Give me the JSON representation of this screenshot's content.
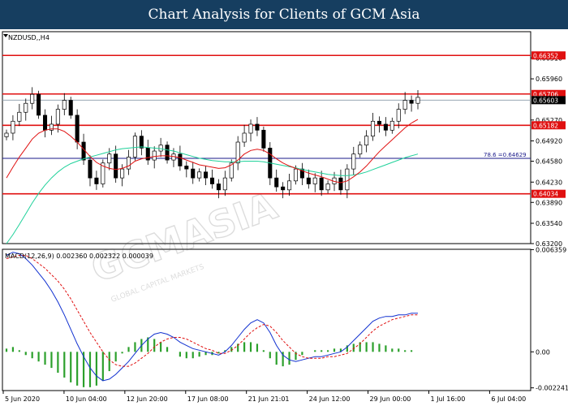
{
  "banner": {
    "title": "Chart Analysis for Clients of GCM Asia"
  },
  "watermark": {
    "text": "GCMASIA",
    "sub": "GLOBAL CAPITAL MARKETS"
  },
  "chart_data": [
    {
      "type": "candlestick",
      "title": "NZDUSD,,H4",
      "ylim": [
        0.632,
        0.6675
      ],
      "y_ticks": [
        "0.66310",
        "0.65960",
        "0.65270",
        "0.64920",
        "0.64580",
        "0.64230",
        "0.63890",
        "0.63540",
        "0.63200"
      ],
      "x_ticks": [
        "5 Jun 2020",
        "10 Jun 04:00",
        "12 Jun 20:00",
        "17 Jun 08:00",
        "21 Jun 21:01",
        "24 Jun 12:00",
        "29 Jun 00:00",
        "1 Jul 16:00",
        "6 Jul 04:00"
      ],
      "levels": [
        {
          "label": "0.66352",
          "value": 0.66352,
          "color": "#e01010"
        },
        {
          "label": "0.65706",
          "value": 0.65706,
          "color": "#e01010"
        },
        {
          "label": "0.65182",
          "value": 0.65182,
          "color": "#e01010"
        },
        {
          "label": "0.64034",
          "value": 0.64034,
          "color": "#e01010"
        }
      ],
      "fib_level": {
        "label": "78.6 =0.64629",
        "value": 0.64629,
        "color": "#1a1a8a"
      },
      "current_price": {
        "label": "0.65603",
        "value": 0.65603
      },
      "series": [
        {
          "kind": "close",
          "color": "#000000",
          "values": [
            0.6505,
            0.6525,
            0.654,
            0.6555,
            0.657,
            0.6535,
            0.651,
            0.652,
            0.6545,
            0.656,
            0.6535,
            0.649,
            0.646,
            0.643,
            0.642,
            0.6455,
            0.647,
            0.643,
            0.6445,
            0.6465,
            0.65,
            0.648,
            0.646,
            0.6475,
            0.6485,
            0.646,
            0.647,
            0.645,
            0.6445,
            0.643,
            0.644,
            0.643,
            0.642,
            0.641,
            0.643,
            0.6455,
            0.649,
            0.6505,
            0.652,
            0.651,
            0.648,
            0.643,
            0.6415,
            0.641,
            0.6425,
            0.6445,
            0.643,
            0.642,
            0.643,
            0.641,
            0.642,
            0.643,
            0.641,
            0.6445,
            0.647,
            0.6485,
            0.65,
            0.6525,
            0.652,
            0.651,
            0.6525,
            0.6545,
            0.656,
            0.6555,
            0.6565
          ]
        },
        {
          "kind": "ma_slow",
          "color": "#1fd19a",
          "values": [
            0.632,
            0.6335,
            0.6352,
            0.637,
            0.6388,
            0.6404,
            0.6418,
            0.643,
            0.644,
            0.6448,
            0.6454,
            0.6458,
            0.6462,
            0.6465,
            0.6468,
            0.6471,
            0.6474,
            0.6477,
            0.6479,
            0.648,
            0.6481,
            0.6482,
            0.6481,
            0.648,
            0.6479,
            0.6477,
            0.6475,
            0.6472,
            0.6469,
            0.6466,
            0.6463,
            0.6461,
            0.6459,
            0.6458,
            0.6457,
            0.6457,
            0.6457,
            0.6458,
            0.6458,
            0.6458,
            0.6457,
            0.6455,
            0.6453,
            0.6451,
            0.6449,
            0.6447,
            0.6444,
            0.6442,
            0.644,
            0.6438,
            0.6436,
            0.6435,
            0.6434,
            0.6434,
            0.6435,
            0.6437,
            0.644,
            0.6444,
            0.6448,
            0.6452,
            0.6456,
            0.646,
            0.6464,
            0.6467,
            0.647
          ]
        },
        {
          "kind": "ma_fast",
          "color": "#e01010",
          "values": [
            0.643,
            0.6448,
            0.6465,
            0.648,
            0.6495,
            0.6505,
            0.651,
            0.6512,
            0.6512,
            0.6508,
            0.65,
            0.649,
            0.6478,
            0.6466,
            0.6456,
            0.645,
            0.6446,
            0.6444,
            0.6446,
            0.645,
            0.6458,
            0.6462,
            0.6464,
            0.6466,
            0.6467,
            0.6467,
            0.6466,
            0.6464,
            0.646,
            0.6456,
            0.6452,
            0.645,
            0.6448,
            0.6446,
            0.6447,
            0.6452,
            0.646,
            0.647,
            0.6476,
            0.6478,
            0.6476,
            0.647,
            0.6462,
            0.6455,
            0.645,
            0.6446,
            0.6442,
            0.6438,
            0.6435,
            0.6432,
            0.6428,
            0.6424,
            0.6422,
            0.6425,
            0.6432,
            0.644,
            0.645,
            0.6462,
            0.6474,
            0.6484,
            0.6494,
            0.6504,
            0.6514,
            0.6522,
            0.6528
          ]
        }
      ]
    },
    {
      "type": "macd",
      "title": "MACD(12,26,9) 0.002360 0.002322 0.000039",
      "ylim": [
        -0.00241,
        0.00638
      ],
      "y_ticks": [
        "0.006359",
        "0.00",
        "-0.002241"
      ],
      "series": [
        {
          "name": "MACD",
          "color": "#1030d0",
          "values": [
            0.006,
            0.0062,
            0.0061,
            0.0058,
            0.0054,
            0.0049,
            0.0044,
            0.0038,
            0.0031,
            0.0023,
            0.0014,
            0.0005,
            -0.0003,
            -0.001,
            -0.0015,
            -0.0018,
            -0.0017,
            -0.0014,
            -0.001,
            -0.0006,
            -0.0001,
            0.0004,
            0.0008,
            0.0011,
            0.0012,
            0.0011,
            0.0009,
            0.0006,
            0.0004,
            0.0002,
            0.0001,
            0.0,
            -0.0001,
            -0.0002,
            0.0,
            0.0004,
            0.0009,
            0.0014,
            0.0018,
            0.002,
            0.0018,
            0.0012,
            0.0004,
            -0.0002,
            -0.0005,
            -0.0006,
            -0.0005,
            -0.0004,
            -0.0003,
            -0.0003,
            -0.0002,
            -0.0001,
            0.0,
            0.0003,
            0.0007,
            0.0011,
            0.0015,
            0.0019,
            0.0021,
            0.0022,
            0.0022,
            0.0023,
            0.0023,
            0.0024,
            0.0024
          ]
        },
        {
          "name": "Signal",
          "color": "#e01010",
          "values": [
            0.0058,
            0.0059,
            0.006,
            0.006,
            0.0058,
            0.0055,
            0.0052,
            0.0048,
            0.0044,
            0.0039,
            0.0033,
            0.0026,
            0.0019,
            0.0012,
            0.0006,
            0.0,
            -0.0005,
            -0.0008,
            -0.0009,
            -0.0009,
            -0.0007,
            -0.0004,
            -0.0001,
            0.0003,
            0.0006,
            0.0008,
            0.0009,
            0.0009,
            0.0008,
            0.0006,
            0.0004,
            0.0002,
            0.0001,
            -0.0001,
            -0.0001,
            0.0001,
            0.0004,
            0.0008,
            0.0012,
            0.0015,
            0.0017,
            0.0016,
            0.0012,
            0.0007,
            0.0003,
            -0.0001,
            -0.0003,
            -0.0004,
            -0.0004,
            -0.0004,
            -0.0003,
            -0.0003,
            -0.0002,
            -0.0001,
            0.0002,
            0.0005,
            0.0009,
            0.0013,
            0.0016,
            0.0018,
            0.002,
            0.0021,
            0.0022,
            0.0023,
            0.0023
          ]
        },
        {
          "name": "Histogram",
          "color": "#2ca02c",
          "values": [
            0.0002,
            0.0003,
            0.0001,
            -0.0002,
            -0.0004,
            -0.0006,
            -0.0008,
            -0.001,
            -0.0013,
            -0.0016,
            -0.0019,
            -0.0021,
            -0.0022,
            -0.0022,
            -0.0021,
            -0.0018,
            -0.0012,
            -0.0006,
            -0.0001,
            0.0003,
            0.0006,
            0.0008,
            0.0009,
            0.0008,
            0.0006,
            0.0003,
            0.0,
            -0.0003,
            -0.0004,
            -0.0004,
            -0.0003,
            -0.0002,
            -0.0002,
            -0.0001,
            0.0001,
            0.0003,
            0.0005,
            0.0006,
            0.0006,
            0.0005,
            0.0001,
            -0.0004,
            -0.0008,
            -0.0009,
            -0.0008,
            -0.0005,
            -0.0002,
            0.0,
            0.0001,
            0.0001,
            0.0001,
            0.0002,
            0.0002,
            0.0004,
            0.0005,
            0.0006,
            0.0006,
            0.0006,
            0.0005,
            0.0004,
            0.0002,
            0.0002,
            0.0001,
            0.0001,
            0.0
          ]
        }
      ]
    }
  ]
}
